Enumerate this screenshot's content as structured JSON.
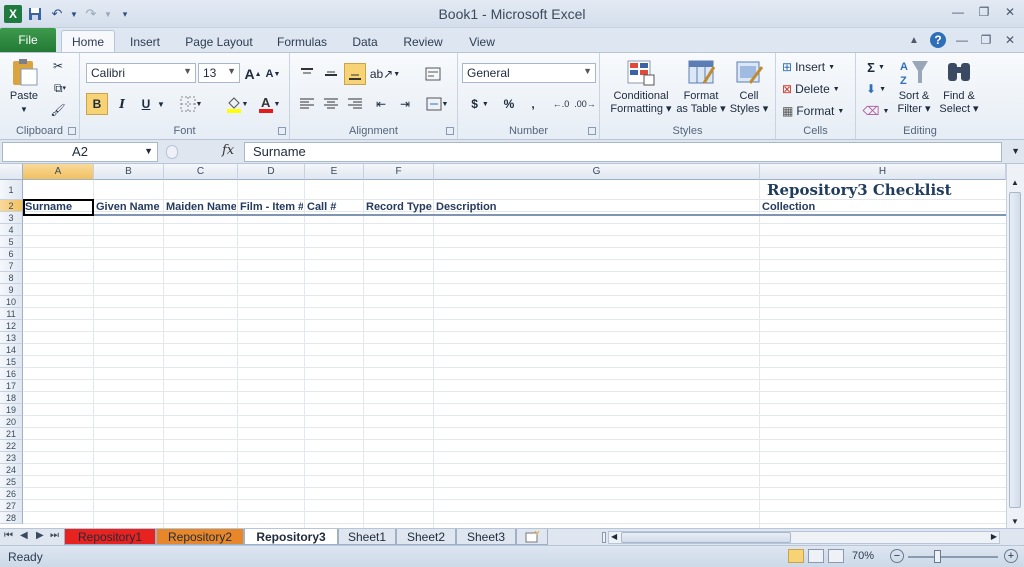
{
  "window": {
    "title": "Book1  -  Microsoft Excel"
  },
  "ribbon_tabs": [
    {
      "label": "File"
    },
    {
      "label": "Home"
    },
    {
      "label": "Insert"
    },
    {
      "label": "Page Layout"
    },
    {
      "label": "Formulas"
    },
    {
      "label": "Data"
    },
    {
      "label": "Review"
    },
    {
      "label": "View"
    }
  ],
  "clipboard": {
    "paste": "Paste",
    "label": "Clipboard"
  },
  "font": {
    "name": "Calibri",
    "size": "13",
    "bold": "B",
    "italic": "I",
    "underline": "U",
    "label": "Font"
  },
  "alignment": {
    "label": "Alignment"
  },
  "number": {
    "format": "General",
    "currency": "$",
    "percent": "%",
    "comma": ",",
    "label": "Number"
  },
  "styles": {
    "cond_line1": "Conditional",
    "cond_line2": "Formatting",
    "table_line1": "Format",
    "table_line2": "as Table",
    "cell_line1": "Cell",
    "cell_line2": "Styles",
    "label": "Styles"
  },
  "cells": {
    "insert": "Insert",
    "delete": "Delete",
    "format": "Format",
    "label": "Cells"
  },
  "editing": {
    "sigma": "Σ",
    "sort_line1": "Sort &",
    "sort_line2": "Filter",
    "find_line1": "Find &",
    "find_line2": "Select",
    "label": "Editing"
  },
  "formula_bar": {
    "cell_ref": "A2",
    "fx": "fx",
    "content": "Surname"
  },
  "columns": [
    "A",
    "B",
    "C",
    "D",
    "E",
    "F",
    "G",
    "H"
  ],
  "rows": [
    "1",
    "2",
    "3",
    "4",
    "5",
    "6",
    "7",
    "8",
    "9",
    "10",
    "11",
    "12",
    "13",
    "14",
    "15",
    "16",
    "17",
    "18",
    "19",
    "20",
    "21",
    "22",
    "23",
    "24",
    "25",
    "26",
    "27",
    "28"
  ],
  "sheet": {
    "title": "Repository3 Checklist",
    "headers": [
      "Surname",
      "Given Name",
      "Maiden Name",
      "Film - Item #",
      "Call #",
      "Record Type",
      "Description",
      "Collection"
    ]
  },
  "sheet_tabs": [
    {
      "label": "Repository1",
      "color": "#e8231f"
    },
    {
      "label": "Repository2",
      "color": "#e8872a"
    },
    {
      "label": "Repository3",
      "color": "#ffffff"
    },
    {
      "label": "Sheet1",
      "color": "#dfe6f0"
    },
    {
      "label": "Sheet2",
      "color": "#dfe6f0"
    },
    {
      "label": "Sheet3",
      "color": "#dfe6f0"
    }
  ],
  "status": {
    "ready": "Ready",
    "zoom": "70%"
  }
}
